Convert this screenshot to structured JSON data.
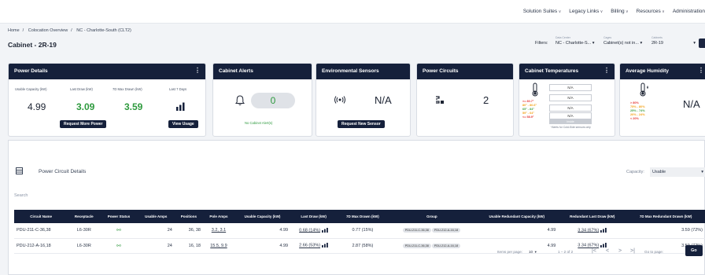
{
  "topnav": [
    "Solution Suites",
    "Legacy Links",
    "Billing",
    "Resources",
    "Administration"
  ],
  "breadcrumb": [
    "Home",
    "Colocation Overview",
    "NC - Charlotte-South (CLT2)"
  ],
  "page_title": "Cabinet - 2R-19",
  "filters": {
    "label": "Filters:",
    "data_center_label": "Data Center",
    "data_center_value": "NC - Charlotte-S...",
    "cages_label": "Cages",
    "cages_value": "Cabinet(s) not in...",
    "cabinets_label": "Cabinets",
    "cabinets_value": "2R-19"
  },
  "power_details": {
    "title": "Power Details",
    "labels": [
      "Usable Capacity (kW)",
      "Last Draw (kW)",
      "7D Max Drawn (kW)",
      "Last 7 Days"
    ],
    "values": [
      "4.99",
      "3.09",
      "3.59"
    ],
    "request_button": "Request More Power",
    "view_button": "View Usage"
  },
  "cabinet_alerts": {
    "title": "Cabinet Alerts",
    "count": "0",
    "note": "No Cabinet Alert(s)"
  },
  "env_sensors": {
    "title": "Environmental Sensors",
    "value": "N/A",
    "button": "Request New Sensor"
  },
  "power_circuits": {
    "title": "Power Circuits",
    "count": "2"
  },
  "cabinet_temps": {
    "title": "Cabinet Temperatures",
    "rows": [
      "N/A",
      "N/A",
      "N/A",
      "N/A"
    ],
    "footer_box": "Inside",
    "note": "*Alerts for Cold-Side sensors only",
    "legend": [
      {
        "text": ">= 80.7°",
        "color": "#e53935"
      },
      {
        "text": "80° - 80.6°",
        "color": "#f4a31a"
      },
      {
        "text": "65° - 84°",
        "color": "#43a047"
      },
      {
        "text": "59° - 64°",
        "color": "#f4a31a"
      },
      {
        "text": "<= 58.9°",
        "color": "#e53935"
      }
    ]
  },
  "avg_humidity": {
    "title": "Average Humidity",
    "value": "N/A",
    "legend": [
      {
        "text": "> 80%",
        "color": "#e53935"
      },
      {
        "text": "75% - 80%",
        "color": "#f4a31a"
      },
      {
        "text": "25% - 74%",
        "color": "#43a047"
      },
      {
        "text": "20% - 24%",
        "color": "#f4a31a"
      },
      {
        "text": "< 20%",
        "color": "#e53935"
      }
    ]
  },
  "circuit_panel": {
    "title": "Power Circuit Details",
    "capacity_label": "Capacity:",
    "capacity_value": "Usable",
    "search_placeholder": "Search"
  },
  "table": {
    "headers": [
      "Circuit Name",
      "Receptacle",
      "Power Status",
      "Usable Amps",
      "Positions",
      "Pole Amps",
      "Usable Capacity (kW)",
      "Last Draw (kW)",
      "7D Max Drawn (kW)",
      "Group",
      "Usable Redundant Capacity (kW)",
      "Redundant Last Draw (kW)",
      "7D Max Redundant Drawn (kW)"
    ],
    "rows": [
      {
        "name": "PDU-211-C-36,38",
        "receptacle": "L6-30R",
        "amps": "24",
        "positions": "36, 38",
        "pole_amps": "3.2, 3.1",
        "capacity": "4.99",
        "last_draw": "0.68 (14%)",
        "max_drawn": "0.77 (15%)",
        "groups": [
          "PDU-211-C-36,38",
          "PDU-212-A-16,18"
        ],
        "red_capacity": "4.99",
        "red_last_draw": "3.34 (67%)",
        "red_max": "3.59 (72%)"
      },
      {
        "name": "PDU-212-A-16,18",
        "receptacle": "L6-30R",
        "amps": "24",
        "positions": "16, 18",
        "pole_amps": "15.5, 9.9",
        "capacity": "4.99",
        "last_draw": "2.66 (53%)",
        "max_drawn": "2.87 (58%)",
        "groups": [
          "PDU-211-C-36,38",
          "PDU-212-A-16,18"
        ],
        "red_capacity": "4.99",
        "red_last_draw": "3.34 (67%)",
        "red_max": "3.59 (72%)"
      }
    ]
  },
  "pagination": {
    "items_label": "Items per page:",
    "items_value": "10",
    "range": "1 – 2 of 2",
    "goto_label": "Go to page:",
    "go_button": "Go"
  },
  "colors": {
    "navy": "#15203b",
    "green": "#2e9a3e",
    "icon_green": "#3f9f4d"
  }
}
